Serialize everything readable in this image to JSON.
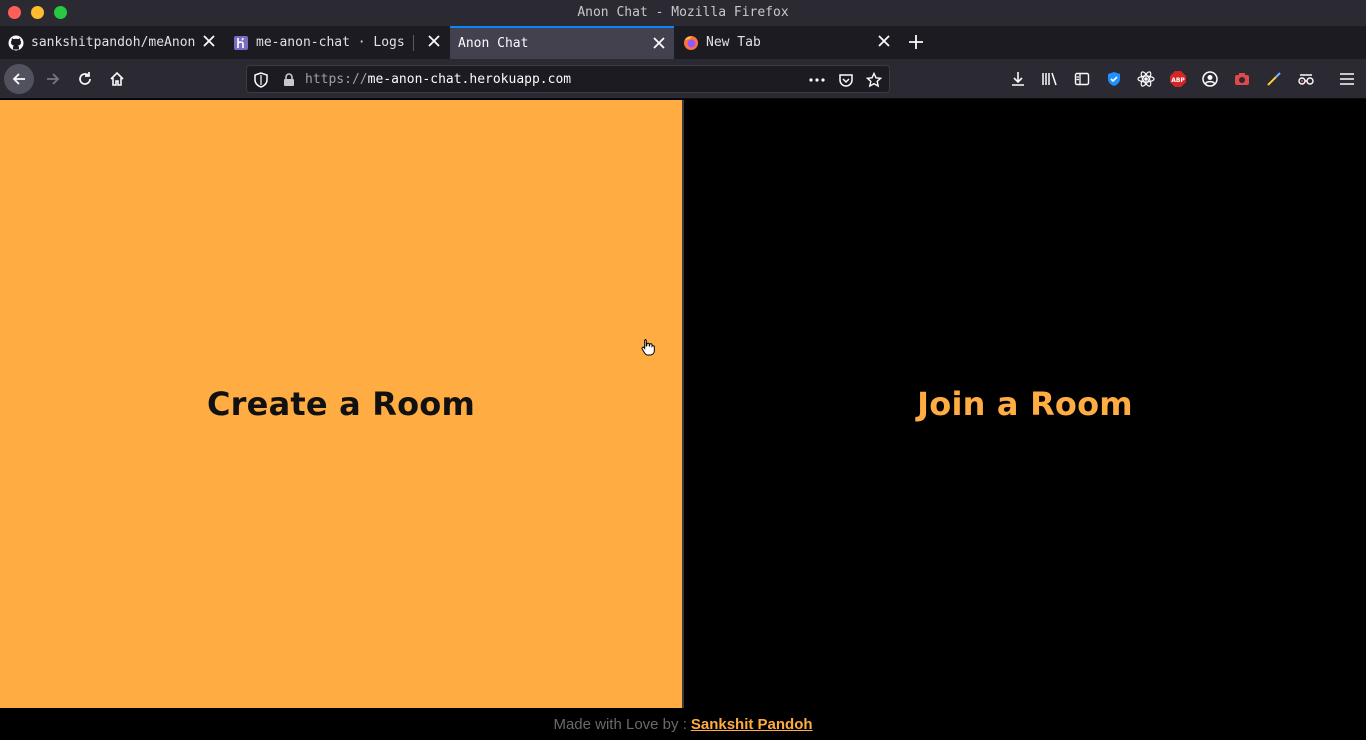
{
  "window": {
    "title": "Anon Chat - Mozilla Firefox"
  },
  "tabs": [
    {
      "label": "sankshitpandoh/meAnonC",
      "icon": "github-icon"
    },
    {
      "label": "me-anon-chat · Logs",
      "icon": "heroku-icon"
    },
    {
      "label": "Anon Chat",
      "icon": "",
      "active": true
    },
    {
      "label": "New Tab",
      "icon": "firefox-icon"
    }
  ],
  "urlbar": {
    "scheme": "https://",
    "host": "me-anon-chat.herokuapp.com"
  },
  "page": {
    "create_label": "Create a Room",
    "join_label": "Join a Room",
    "footer_prefix": "Made with Love by :",
    "footer_author": "Sankshit Pandoh"
  },
  "colors": {
    "accent": "#ffac42",
    "page_bg": "#000000",
    "tab_active_line": "#0a84ff"
  }
}
